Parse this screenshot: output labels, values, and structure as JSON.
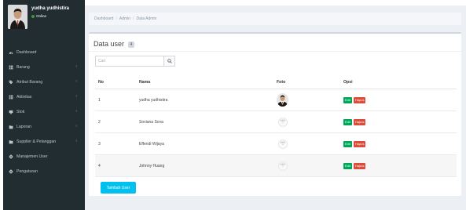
{
  "user": {
    "name": "yudha yudhistira",
    "status": "Online"
  },
  "sidebar": {
    "items": [
      {
        "label": "Dashboard",
        "icon": "dashboard-icon",
        "has_submenu": false
      },
      {
        "label": "Barang",
        "icon": "table-icon",
        "has_submenu": true
      },
      {
        "label": "Atribut Barang",
        "icon": "tag-icon",
        "has_submenu": true
      },
      {
        "label": "Aktivitas",
        "icon": "table-icon",
        "has_submenu": true
      },
      {
        "label": "Stok",
        "icon": "monitor-icon",
        "has_submenu": true
      },
      {
        "label": "Laporan",
        "icon": "folder-icon",
        "has_submenu": true
      },
      {
        "label": "Supplier & Pelanggan",
        "icon": "folder-icon",
        "has_submenu": true
      },
      {
        "label": "Manajemen User",
        "icon": "gear-icon",
        "has_submenu": false
      },
      {
        "label": "Pengaturan",
        "icon": "gear-icon",
        "has_submenu": false
      }
    ]
  },
  "breadcrumb": {
    "items": [
      "Dashboard",
      "Admin",
      "Data Admin"
    ],
    "separator": "/"
  },
  "box": {
    "title": "Data user",
    "count_badge": "4",
    "search": {
      "placeholder": "Cari",
      "value": ""
    }
  },
  "table": {
    "columns": [
      "No",
      "Nama",
      "Foto",
      "Opsi"
    ],
    "rows": [
      {
        "no": "1",
        "nama": "yudha yudhistira",
        "foto": "photo"
      },
      {
        "no": "2",
        "nama": "Soviana Sova",
        "foto": "no-photo"
      },
      {
        "no": "3",
        "nama": "Effendi Wijaya",
        "foto": "no-photo"
      },
      {
        "no": "4",
        "nama": "Johnny Huang",
        "foto": "no-photo"
      }
    ],
    "edit_label": "Edit",
    "delete_label": "Hapus",
    "no_photo_text": "NO"
  },
  "add_button_label": "Tambah User",
  "colors": {
    "sidebar_bg": "#222d32",
    "sidebar_text": "#b8c7ce",
    "content_bg": "#ecf0f5",
    "edit_green": "#00a65a",
    "delete_red": "#dd4b39",
    "add_blue": "#00c0ef",
    "online_green": "#3c9a3c"
  }
}
